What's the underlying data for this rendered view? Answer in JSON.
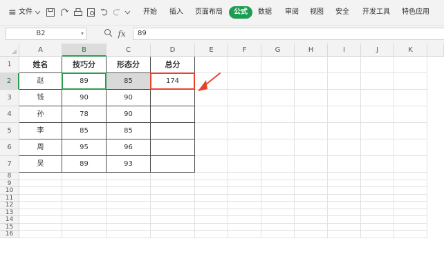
{
  "toolbar": {
    "hamburger": "≡",
    "file_menu": "文件",
    "menu_tabs": [
      "开始",
      "插入",
      "页面布局",
      "公式",
      "数据",
      "审阅",
      "视图",
      "安全",
      "开发工具",
      "特色应用"
    ],
    "active_tab": "公式"
  },
  "formula_bar": {
    "name_box": "B2",
    "fx_label": "fx",
    "value": "89"
  },
  "sheet": {
    "columns": [
      "A",
      "B",
      "C",
      "D",
      "E",
      "F",
      "G",
      "H",
      "I",
      "J",
      "K"
    ],
    "rows": [
      "1",
      "2",
      "3",
      "4",
      "5",
      "6",
      "7",
      "8",
      "9",
      "10",
      "11",
      "12",
      "13",
      "14",
      "15",
      "16"
    ],
    "table_header": [
      "姓名",
      "技巧分",
      "形态分",
      "总分"
    ],
    "table_rows": [
      [
        "赵",
        "89",
        "85",
        "174"
      ],
      [
        "钱",
        "90",
        "90",
        ""
      ],
      [
        "孙",
        "78",
        "90",
        ""
      ],
      [
        "李",
        "85",
        "85",
        ""
      ],
      [
        "周",
        "95",
        "96",
        ""
      ],
      [
        "吴",
        "89",
        "93",
        ""
      ]
    ]
  },
  "colors": {
    "active_tab": "#1e9d52",
    "selection_border": "#2c9b4c",
    "highlight_border": "#e8412c",
    "arrow": "#e8412c"
  }
}
